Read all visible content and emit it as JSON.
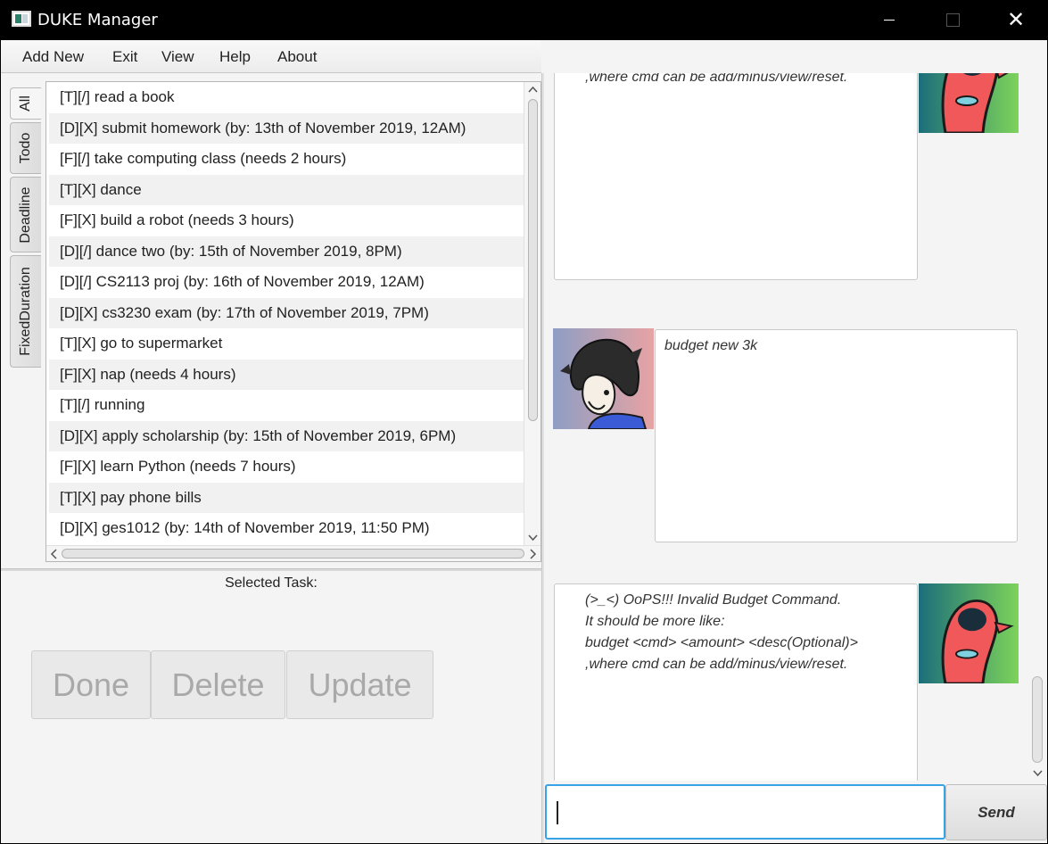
{
  "window": {
    "title": "DUKE Manager",
    "minimize_glyph": "",
    "maximize_glyph": "",
    "close_glyph": "✕"
  },
  "menu": {
    "items": [
      "Add New",
      "Exit",
      "View",
      "Help",
      "About"
    ]
  },
  "tabs": [
    {
      "label": "All",
      "active": true
    },
    {
      "label": "Todo",
      "active": false
    },
    {
      "label": "Deadline",
      "active": false
    },
    {
      "label": "FixedDuration",
      "active": false
    }
  ],
  "tasks": [
    "[T][/] read a book",
    "[D][X] submit homework (by: 13th of November 2019, 12AM)",
    "[F][/] take computing class (needs 2 hours)",
    "[T][X] dance",
    "[F][X] build a robot (needs 3 hours)",
    "[D][/] dance two (by: 15th of November 2019, 8PM)",
    "[D][/] CS2113 proj (by: 16th of November 2019, 12AM)",
    "[D][X] cs3230 exam (by: 17th of November 2019, 7PM)",
    "[T][X] go to supermarket",
    "[F][X] nap (needs 4 hours)",
    "[T][/] running",
    "[D][X] apply scholarship (by: 15th of November 2019, 6PM)",
    "[F][X] learn Python (needs 7 hours)",
    "[T][X] pay phone bills",
    "[D][X] ges1012 (by: 14th of November 2019, 11:50 PM)"
  ],
  "detail": {
    "selected_label": "Selected Task:",
    "done_label": "Done",
    "delete_label": "Delete",
    "update_label": "Update"
  },
  "chat": {
    "messages": [
      {
        "from": "duke",
        "text": "budget <cmd> <amount> <desc(Optional)>\n,where cmd can be add/minus/view/reset."
      },
      {
        "from": "user",
        "text": "budget new 3k"
      },
      {
        "from": "duke",
        "text": "(>_<) OoPS!!! Invalid Budget Command.\nIt should be more like:\nbudget <cmd> <amount> <desc(Optional)>\n,where cmd can be add/minus/view/reset."
      }
    ],
    "input_value": "",
    "send_label": "Send"
  },
  "colors": {
    "input_focus": "#37a3e6",
    "duke_avatar_bg_from": "#1b6e7a",
    "duke_avatar_bg_to": "#7dd35a",
    "duke_body": "#f0585a",
    "user_avatar_bg": "#c98a9a"
  }
}
